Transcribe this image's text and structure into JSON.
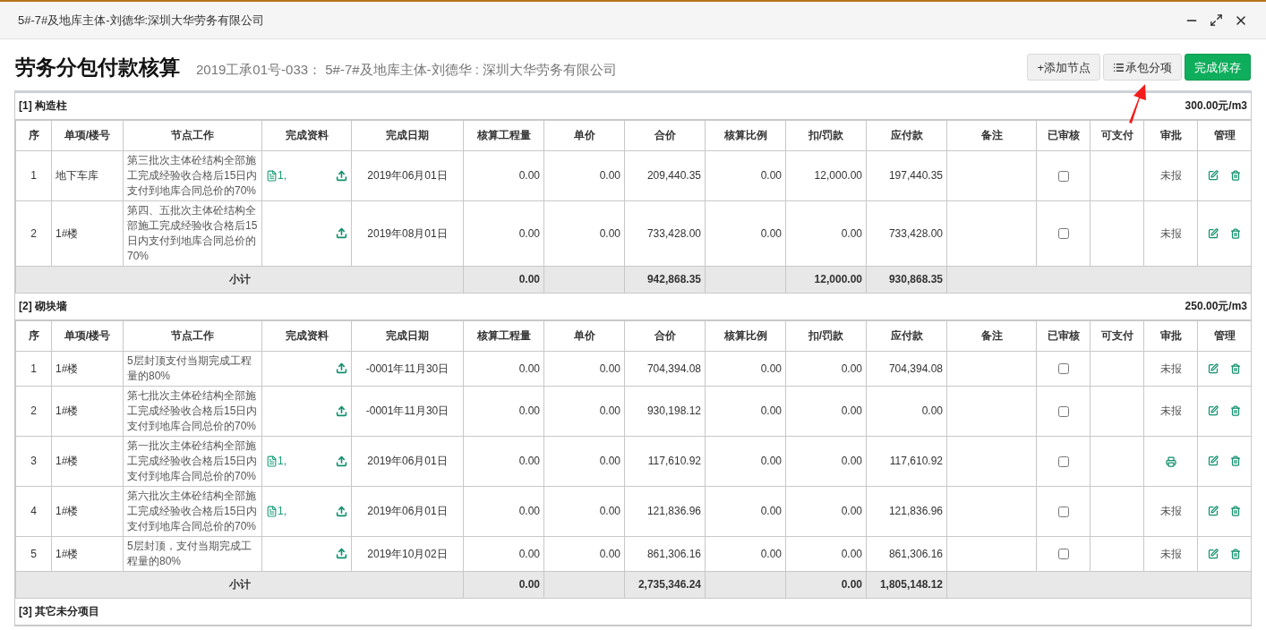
{
  "window": {
    "title": "5#-7#及地库主体-刘德华:深圳大华劳务有限公司"
  },
  "header": {
    "title": "劳务分包付款核算",
    "subtitle": "2019工承01号-033： 5#-7#及地库主体-刘德华 : 深圳大华劳务有限公司",
    "buttons": [
      {
        "label": "+添加节点",
        "kind": "plain"
      },
      {
        "label": "承包分项",
        "kind": "list"
      },
      {
        "label": "完成保存",
        "kind": "primary"
      }
    ]
  },
  "sections": [
    {
      "title": "[1] 构造柱",
      "rate": "300.00元/m3",
      "columns": [
        "序",
        "单项/楼号",
        "节点工作",
        "完成资料",
        "完成日期",
        "核算工程量",
        "单价",
        "合价",
        "核算比例",
        "扣/罚款",
        "应付款",
        "备注",
        "已审核",
        "可支付",
        "审批",
        "管理"
      ],
      "rows": [
        {
          "seq": "1",
          "item": "地下车库",
          "node": "第三批次主体砼结构全部施工完成经验收合格后15日内支付到地库合同总价的70%",
          "files": "1,",
          "date": "2019年06月01日",
          "qty": "0.00",
          "price": "0.00",
          "total": "209,440.35",
          "ratio": "0.00",
          "deduct": "12,000.00",
          "payable": "197,440.35",
          "checked": false,
          "approval": {
            "kind": "text",
            "text": "未报"
          }
        },
        {
          "seq": "2",
          "item": "1#楼",
          "node": "第四、五批次主体砼结构全部施工完成经验收合格后15日内支付到地库合同总价的70%",
          "date": "2019年08月01日",
          "qty": "0.00",
          "price": "0.00",
          "total": "733,428.00",
          "ratio": "0.00",
          "deduct": "0.00",
          "payable": "733,428.00",
          "checked": false,
          "approval": {
            "kind": "text",
            "text": "未报"
          }
        }
      ],
      "subtotal": {
        "label": "小计",
        "qty": "0.00",
        "total": "942,868.35",
        "deduct": "12,000.00",
        "payable": "930,868.35"
      }
    },
    {
      "title": "[2] 砌块墙",
      "rate": "250.00元/m3",
      "columns": [
        "序",
        "单项/楼号",
        "节点工作",
        "完成资料",
        "完成日期",
        "核算工程量",
        "单价",
        "合价",
        "核算比例",
        "扣/罚款",
        "应付款",
        "备注",
        "已审核",
        "可支付",
        "审批",
        "管理"
      ],
      "rows": [
        {
          "seq": "1",
          "item": "1#楼",
          "node": "5层封顶支付当期完成工程量的80%",
          "date": "-0001年11月30日",
          "qty": "0.00",
          "price": "0.00",
          "total": "704,394.08",
          "ratio": "0.00",
          "deduct": "0.00",
          "payable": "704,394.08",
          "checked": false,
          "approval": {
            "kind": "text",
            "text": "未报"
          }
        },
        {
          "seq": "2",
          "item": "1#楼",
          "node": "第七批次主体砼结构全部施工完成经验收合格后15日内支付到地库合同总价的70%",
          "date": "-0001年11月30日",
          "qty": "0.00",
          "price": "0.00",
          "total": "930,198.12",
          "ratio": "0.00",
          "deduct": "0.00",
          "payable": "0.00",
          "checked": false,
          "approval": {
            "kind": "text",
            "text": "未报"
          }
        },
        {
          "seq": "3",
          "item": "1#楼",
          "node": "第一批次主体砼结构全部施工完成经验收合格后15日内支付到地库合同总价的70%",
          "files": "1,",
          "date": "2019年06月01日",
          "qty": "0.00",
          "price": "0.00",
          "total": "117,610.92",
          "ratio": "0.00",
          "deduct": "0.00",
          "payable": "117,610.92",
          "checked": false,
          "approval": {
            "kind": "print"
          }
        },
        {
          "seq": "4",
          "item": "1#楼",
          "node": "第六批次主体砼结构全部施工完成经验收合格后15日内支付到地库合同总价的70%",
          "files": "1,",
          "date": "2019年06月01日",
          "qty": "0.00",
          "price": "0.00",
          "total": "121,836.96",
          "ratio": "0.00",
          "deduct": "0.00",
          "payable": "121,836.96",
          "checked": false,
          "approval": {
            "kind": "text",
            "text": "未报"
          }
        },
        {
          "seq": "5",
          "item": "1#楼",
          "node": "5层封顶，支付当期完成工程量的80%",
          "date": "2019年10月02日",
          "qty": "0.00",
          "price": "0.00",
          "total": "861,306.16",
          "ratio": "0.00",
          "deduct": "0.00",
          "payable": "861,306.16",
          "checked": false,
          "approval": {
            "kind": "text",
            "text": "未报"
          }
        }
      ],
      "subtotal": {
        "label": "小计",
        "qty": "0.00",
        "total": "2,735,346.24",
        "deduct": "0.00",
        "payable": "1,805,148.12"
      }
    },
    {
      "title": "[3] 其它未分项目"
    }
  ]
}
